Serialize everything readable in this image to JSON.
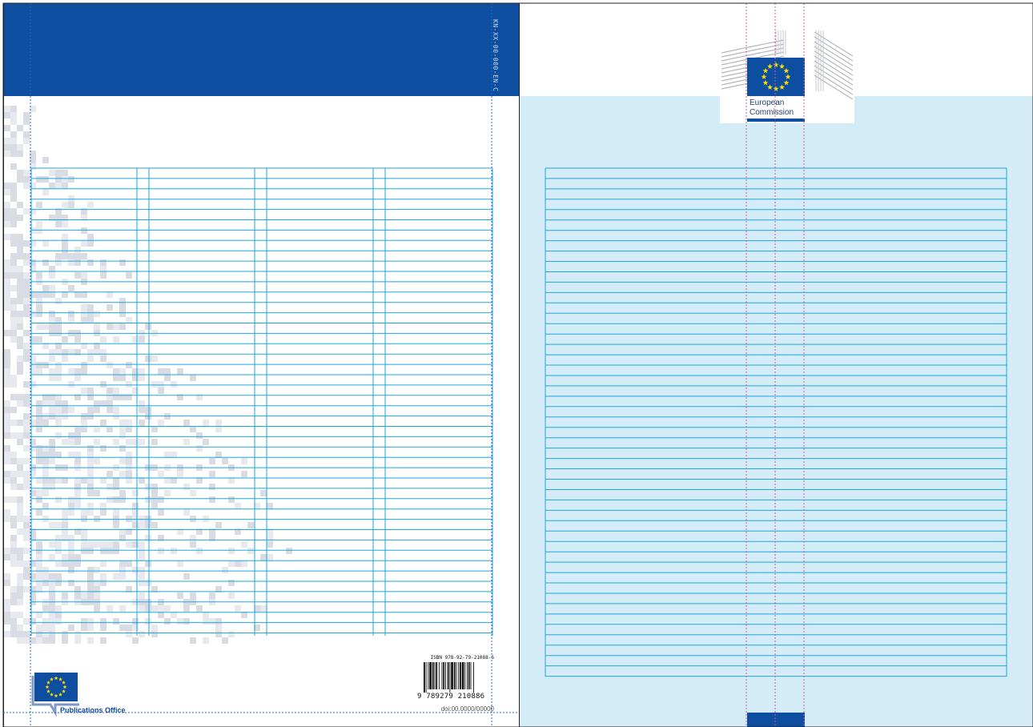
{
  "back_cover": {
    "spine_code": "KN-XX-00-000-EN-C",
    "isbn": "ISBN 978-92-79-21088-6",
    "barcode_digits": "9 789279 210886",
    "doi": "doi:00.0000/00000",
    "publisher_label": "Publications Office"
  },
  "front_cover": {
    "org_line1": "European",
    "org_line2": "Commission"
  },
  "colors": {
    "brand_blue": "#0d4ea0",
    "grid_line": "#1fa5e0",
    "light_panel": "#d4ebf8",
    "guide_magenta": "#d45aa0",
    "guide_blue": "#2a6ac8",
    "eu_star": "#ffdd00"
  },
  "icons": [
    "eu-flag-icon",
    "commission-building-icon",
    "barcode-icon"
  ]
}
